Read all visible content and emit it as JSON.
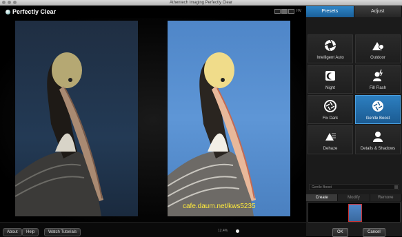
{
  "window": {
    "title": "Athentech Imaging Perfectly Clear"
  },
  "app": {
    "name": "Perfectly Clear"
  },
  "header": {
    "view_mode_label": "HV"
  },
  "tabs": {
    "presets": "Presets",
    "adjust": "Adjust"
  },
  "presets": [
    {
      "label": "Intelligent Auto",
      "icon": "camera-aperture-icon"
    },
    {
      "label": "Outdoor",
      "icon": "landscape-sun-icon"
    },
    {
      "label": "Night",
      "icon": "moon-icon"
    },
    {
      "label": "Fill Flash",
      "icon": "portrait-flash-icon"
    },
    {
      "label": "Fix Dark",
      "icon": "aperture-icon"
    },
    {
      "label": "Gentle Boost",
      "icon": "aperture-boost-icon",
      "active": true
    },
    {
      "label": "Dehaze",
      "icon": "dehaze-icon"
    },
    {
      "label": "Details & Shadows",
      "icon": "portrait-detail-icon"
    }
  ],
  "preset_name": "Gentle Boost",
  "subtabs": {
    "create": "Create",
    "modify": "Modify",
    "remove": "Remove"
  },
  "buttons": {
    "ok": "OK",
    "cancel": "Cancel",
    "about": "About",
    "help": "Help",
    "watch_tutorials": "Watch Tutorials"
  },
  "zoom": "12.4%",
  "watermark": "cafe.daum.net/kws5235",
  "colors": {
    "accent": "#2f86c8",
    "before_bg": "#233a55",
    "after_bg": "#5e96d6",
    "watermark": "#ffeb3b"
  }
}
